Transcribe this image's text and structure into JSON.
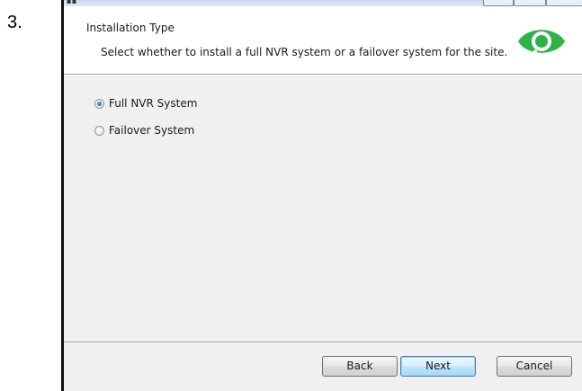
{
  "step_number": "3.",
  "header": {
    "title": "Installation Type",
    "description": "Select whether to install a full NVR system or a failover system for the site."
  },
  "options": [
    {
      "label": "Full NVR System",
      "selected": true
    },
    {
      "label": "Failover System",
      "selected": false
    }
  ],
  "buttons": {
    "back": "Back",
    "next": "Next",
    "cancel": "Cancel"
  },
  "colors": {
    "logo_green": "#2db34a",
    "default_button_border": "#3c7fb1"
  },
  "icons": {
    "logo": "green-eye-logo-icon"
  }
}
